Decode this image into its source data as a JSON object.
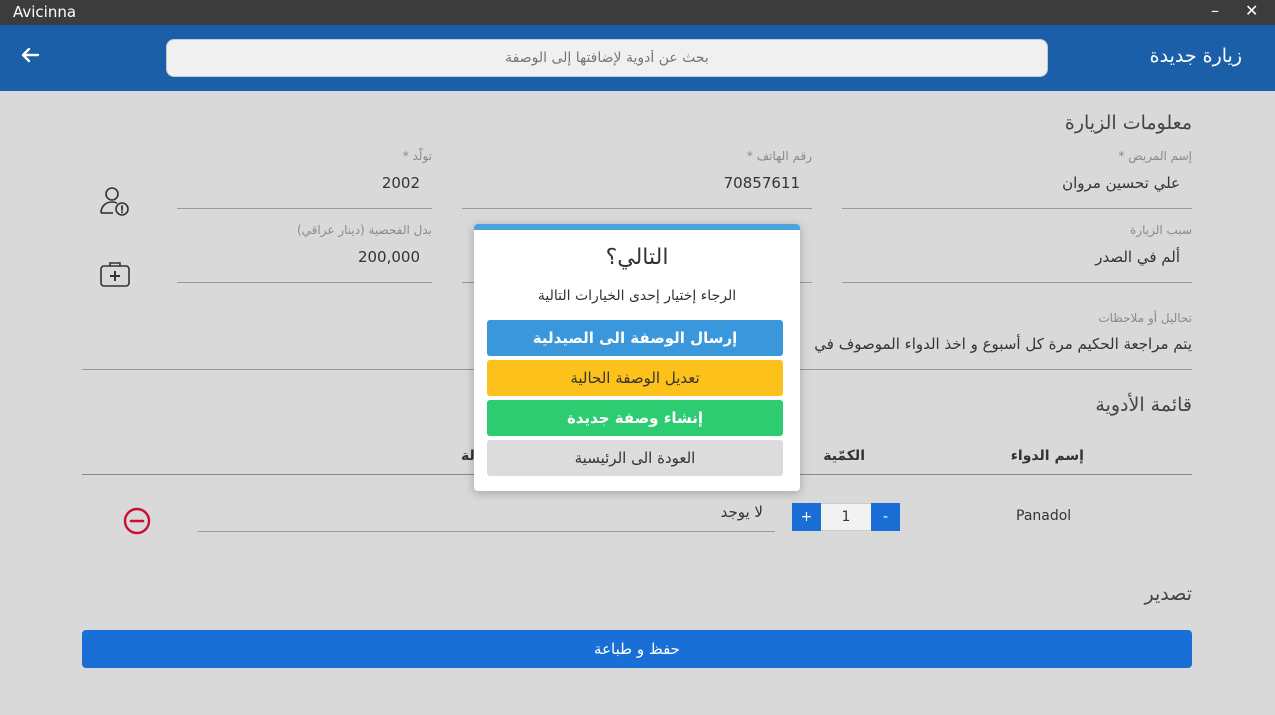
{
  "window": {
    "title": "Avicinna",
    "minimize": "–",
    "close": "✕"
  },
  "appbar": {
    "title": "زيارة جديدة",
    "search_placeholder": "بحث عن أدوية لإضافتها إلى الوصفة",
    "back_icon": "arrow-left-icon"
  },
  "visit_info": {
    "section_title": "معلومات الزيارة",
    "patient_name": {
      "label": "إسم المريض *",
      "value": "علي تحسين مروان"
    },
    "phone": {
      "label": "رقم الهاتف *",
      "value": "70857611"
    },
    "birth_year": {
      "label": "تولّد *",
      "value": "2002"
    },
    "visit_reason": {
      "label": "سبب الزيارة",
      "value": "ألم في الصدر"
    },
    "fee": {
      "label": "بدل الفحصية (دينار عراقي)",
      "value": "200,000"
    },
    "notes": {
      "label": "تحاليل أو ملاحظات",
      "value": "يتم مراجعة الحكيم مرة كل أسبوع و اخذ الدواء الموصوف في"
    }
  },
  "medicines": {
    "section_title": "قائمة الأدوية",
    "columns": {
      "name": "إسم الدواء",
      "quantity": "الكمّية",
      "note_partial": "لة"
    },
    "rows": [
      {
        "name": "Panadol",
        "quantity": "1",
        "minus": "-",
        "plus": "+",
        "note": "لا يوجد"
      }
    ]
  },
  "export": {
    "section_title": "تصدير",
    "save_print": "حفظ و طباعة"
  },
  "dialog": {
    "title": "التالي؟",
    "subtitle": "الرجاء إختيار إحدى الخيارات التالية",
    "send_pharmacy": "إرسال الوصفة الى الصيدلية",
    "edit_current": "تعديل الوصفة الحالية",
    "new_prescription": "إنشاء وصفة جديدة",
    "back_home": "العودة الى الرئيسية"
  },
  "colors": {
    "appbar": "#1a5fa8",
    "primary": "#1a6fd6",
    "send": "#3a97dc",
    "edit": "#fdc11c",
    "new": "#2ecc71",
    "remove": "#c8102e"
  }
}
